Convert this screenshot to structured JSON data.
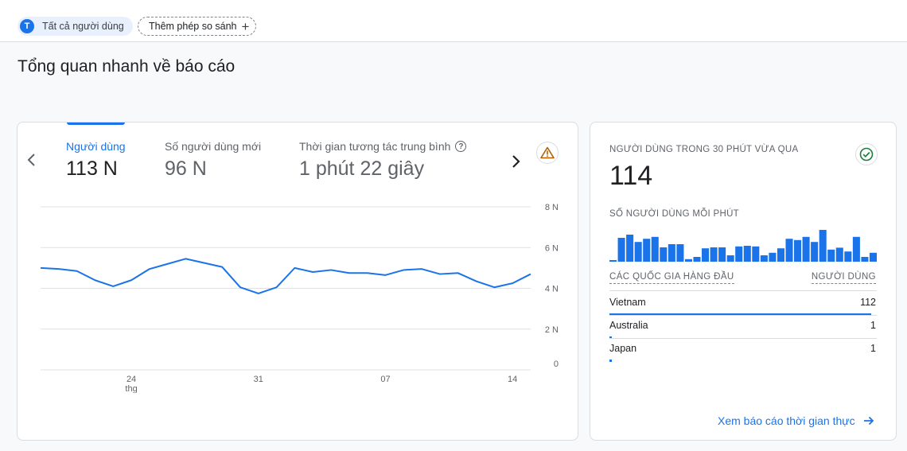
{
  "filters": {
    "user_avatar_letter": "T",
    "all_users_label": "Tất cả người dùng",
    "add_comparison_label": "Thêm phép so sánh"
  },
  "page_title": "Tổng quan nhanh về báo cáo",
  "metrics": [
    {
      "label": "Người dùng",
      "value": "113 N",
      "active": true
    },
    {
      "label": "Số người dùng mới",
      "value": "96 N",
      "active": false
    },
    {
      "label": "Thời gian tương tác trung bình",
      "value": "1 phút 22 giây",
      "active": false
    }
  ],
  "colors": {
    "accent": "#1a73e8",
    "warning": "#b06000",
    "success": "#188038"
  },
  "chart_data": {
    "type": "line",
    "series": [
      {
        "values": [
          5.0,
          4.95,
          4.85,
          4.4,
          4.1,
          4.4,
          4.95,
          5.2,
          5.45,
          5.25,
          5.05,
          4.05,
          3.75,
          4.05,
          5.0,
          4.8,
          4.9,
          4.75,
          4.75,
          4.65,
          4.9,
          4.95,
          4.7,
          4.75,
          4.35,
          4.05,
          4.25,
          4.7
        ]
      }
    ],
    "ylim": [
      0,
      8
    ],
    "y_ticks": [
      {
        "value": 8,
        "label": "8 N"
      },
      {
        "value": 6,
        "label": "6 N"
      },
      {
        "value": 4,
        "label": "4 N"
      },
      {
        "value": 2,
        "label": "2 N"
      },
      {
        "value": 0,
        "label": "0"
      }
    ],
    "x_ticks": [
      {
        "index": 5,
        "label": "24",
        "sub": "thg"
      },
      {
        "index": 12,
        "label": "31",
        "sub": ""
      },
      {
        "index": 19,
        "label": "07",
        "sub": ""
      },
      {
        "index": 26,
        "label": "14",
        "sub": ""
      }
    ],
    "grid": true
  },
  "realtime": {
    "title": "NGƯỜI DÙNG TRONG 30 PHÚT VỪA QUA",
    "count": "114",
    "per_minute_label": "SỐ NGƯỜI DÙNG MỖI PHÚT",
    "per_minute_values": [
      0.05,
      0.75,
      0.85,
      0.62,
      0.72,
      0.78,
      0.45,
      0.55,
      0.55,
      0.08,
      0.15,
      0.42,
      0.45,
      0.45,
      0.2,
      0.48,
      0.5,
      0.48,
      0.2,
      0.28,
      0.42,
      0.72,
      0.68,
      0.78,
      0.62,
      1.0,
      0.38,
      0.44,
      0.32,
      0.78,
      0.15,
      0.28
    ],
    "table_header_country": "CÁC QUỐC GIA HÀNG ĐẦU",
    "table_header_users": "NGƯỜI DÙNG",
    "countries": [
      {
        "name": "Vietnam",
        "users": "112",
        "share": 0.98
      },
      {
        "name": "Australia",
        "users": "1",
        "share": 0.01
      },
      {
        "name": "Japan",
        "users": "1",
        "share": 0.01
      }
    ],
    "link_label": "Xem báo cáo thời gian thực"
  }
}
